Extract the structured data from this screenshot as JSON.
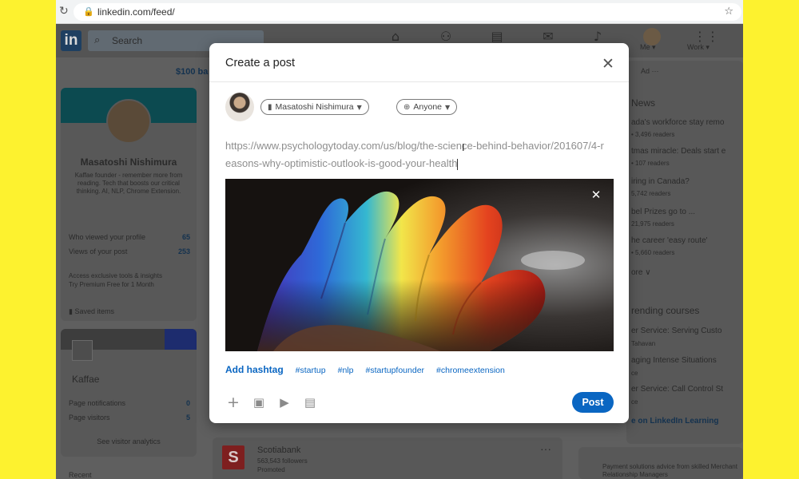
{
  "browser": {
    "url": "linkedin.com/feed/"
  },
  "linkedin": {
    "logo_text": "in",
    "search_placeholder": "Search",
    "nav": {
      "me_label": "Me ▾",
      "work_label": "Work ▾"
    },
    "premium_strip": "$100 ba",
    "profile": {
      "name": "Masatoshi Nishimura",
      "description": "Kaffae founder - remember more from reading. Tech that boosts our critical thinking. AI, NLP, Chrome Extension.",
      "stats": [
        {
          "label": "Who viewed your profile",
          "value": "65"
        },
        {
          "label": "Views of your post",
          "value": "253"
        }
      ],
      "access_text": "Access exclusive tools & insights",
      "premium_text": "Try Premium Free for 1 Month",
      "saved_items": "Saved items"
    },
    "page": {
      "name": "Kaffae",
      "stats": [
        {
          "label": "Page notifications",
          "value": "0"
        },
        {
          "label": "Page visitors",
          "value": "5"
        }
      ],
      "analytics": "See visitor analytics"
    },
    "recent": "Recent",
    "right": {
      "ad_text": "Ad ···",
      "news_title": "News",
      "news": [
        {
          "headline": "ada's workforce stay remo",
          "readers": "• 3,496 readers"
        },
        {
          "headline": "tmas miracle: Deals start e",
          "readers": "• 107 readers"
        },
        {
          "headline": "iring in Canada?",
          "readers": "5,742 readers"
        },
        {
          "headline": "bel Prizes go to ...",
          "readers": "21,975 readers"
        },
        {
          "headline": "he career 'easy route'",
          "readers": "• 5,660 readers"
        }
      ],
      "show_more": "ore ∨",
      "courses_title": "rending courses",
      "courses": [
        {
          "title": "er Service: Serving Custo",
          "author": "Tahavan"
        },
        {
          "title": "aging Intense Situations",
          "author": "ce"
        },
        {
          "title": "er Service: Call Control St",
          "author": "ce"
        }
      ],
      "learning_link": "e on LinkedIn Learning"
    },
    "feed_post": {
      "logo_text": "S",
      "company": "Scotiabank",
      "followers": "563,543 followers",
      "promoted": "Promoted",
      "dots": "···"
    },
    "ad_card_text": "Payment solutions advice from skilled Merchant Relationship Managers"
  },
  "modal": {
    "title": "Create a post",
    "author_name": "Masatoshi Nishimura",
    "visibility": "Anyone",
    "post_text": "https://www.psychologytoday.com/us/blog/the-science-behind-behavior/201607/4-reasons-why-optimistic-outlook-is-good-your-health",
    "add_hashtag_label": "Add hashtag",
    "hashtags": [
      "#startup",
      "#nlp",
      "#startupfounder",
      "#chromeextension"
    ],
    "post_button": "Post"
  },
  "colors": {
    "background_yellow": "#fdf22f",
    "linkedin_blue": "#0a66c2"
  }
}
